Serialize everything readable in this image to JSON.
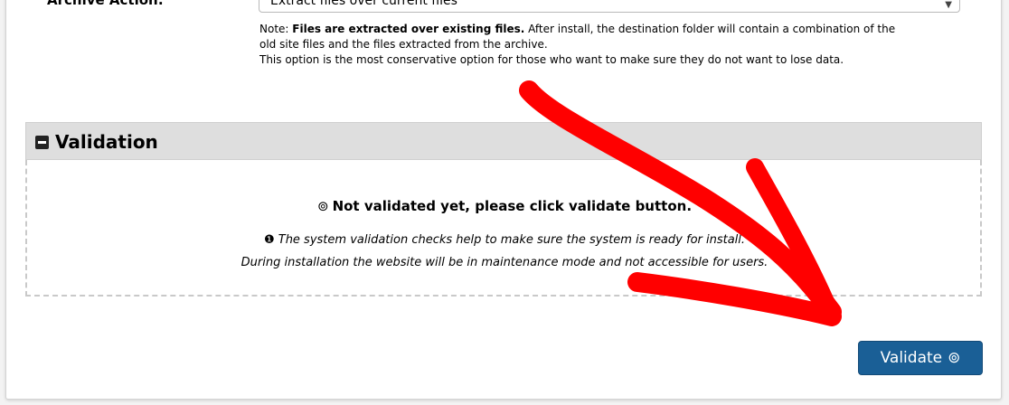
{
  "archive": {
    "label": "Archive Action:",
    "selected": "Extract files over current files",
    "note_prefix": "Note: ",
    "note_bold": "Files are extracted over existing files.",
    "note_line1_rest": " After install, the destination folder will contain a combination of the",
    "note_line2": "old site files and the files extracted from the archive.",
    "note_line3": "This option is the most conservative option for those who want to make sure they do not want to lose data."
  },
  "validation": {
    "title": "Validation",
    "status_icon": "check-circle-icon",
    "status_text": "Not validated yet, please click validate button.",
    "info_icon": "info-icon",
    "info_line1": "The system validation checks help to make sure the system is ready for install.",
    "info_line2": "During installation the website will be in maintenance mode and not accessible for users."
  },
  "validate_button": {
    "label": "Validate",
    "icon": "check-circle-icon",
    "color": "#1a5f96"
  },
  "annotation": {
    "arrow_color": "#ff0000"
  }
}
